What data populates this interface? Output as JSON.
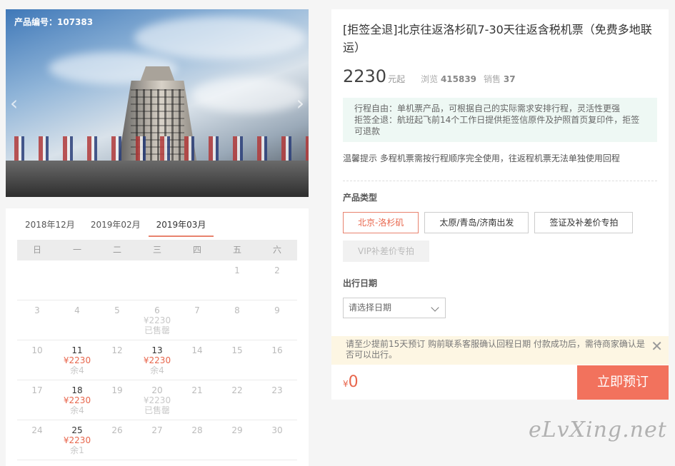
{
  "product": {
    "code_label": "产品编号：107383",
    "title": "[拒签全退]北京往返洛杉矶7-30天往返含税机票（免费多地联运）",
    "price": "2230",
    "price_unit": "元起",
    "views_label": "浏览",
    "views": "415839",
    "sales_label": "销售",
    "sales": "37"
  },
  "notice": {
    "line1": "行程自由：单机票产品，可根据自己的实际需求安排行程，灵活性更强",
    "line2": "拒签全退：航班起飞前14个工作日提供拒签信原件及护照首页复印件，拒签可退款"
  },
  "tip": "温馨提示 多程机票需按行程顺序完全使用，往返程机票无法单独使用回程",
  "product_type": {
    "label": "产品类型",
    "options": [
      "北京-洛杉矶",
      "太原/青岛/济南出发",
      "签证及补差价专拍",
      "VIP补差价专拍"
    ]
  },
  "date_select": {
    "label": "出行日期",
    "placeholder": "请选择日期"
  },
  "warning": "请至少提前15天预订 购前联系客服确认回程日期 付款成功后，需待商家确认是否可以出行。",
  "total": {
    "currency": "¥",
    "amount": "0"
  },
  "book_label": "立即预订",
  "calendar": {
    "months": [
      "2018年12月",
      "2019年02月",
      "2019年03月"
    ],
    "weekdays": [
      "日",
      "一",
      "二",
      "三",
      "四",
      "五",
      "六"
    ],
    "rows": [
      [
        {
          "d": ""
        },
        {
          "d": ""
        },
        {
          "d": ""
        },
        {
          "d": ""
        },
        {
          "d": ""
        },
        {
          "d": "1"
        },
        {
          "d": "2"
        }
      ],
      [
        {
          "d": "3"
        },
        {
          "d": "4"
        },
        {
          "d": "5"
        },
        {
          "d": "6",
          "p": "¥2230",
          "s": "已售罄",
          "gone": true
        },
        {
          "d": "7"
        },
        {
          "d": "8"
        },
        {
          "d": "9"
        }
      ],
      [
        {
          "d": "10"
        },
        {
          "d": "11",
          "p": "¥2230",
          "s": "余4"
        },
        {
          "d": "12"
        },
        {
          "d": "13",
          "p": "¥2230",
          "s": "余4"
        },
        {
          "d": "14"
        },
        {
          "d": "15"
        },
        {
          "d": "16"
        }
      ],
      [
        {
          "d": "17"
        },
        {
          "d": "18",
          "p": "¥2230",
          "s": "余4"
        },
        {
          "d": "19"
        },
        {
          "d": "20",
          "p": "¥2230",
          "s": "已售罄",
          "gone": true
        },
        {
          "d": "21"
        },
        {
          "d": "22"
        },
        {
          "d": "23"
        }
      ],
      [
        {
          "d": "24"
        },
        {
          "d": "25",
          "p": "¥2230",
          "s": "余1"
        },
        {
          "d": "26"
        },
        {
          "d": "27"
        },
        {
          "d": "28"
        },
        {
          "d": "29"
        },
        {
          "d": "30"
        }
      ]
    ]
  },
  "watermark": "eLvXing.net"
}
